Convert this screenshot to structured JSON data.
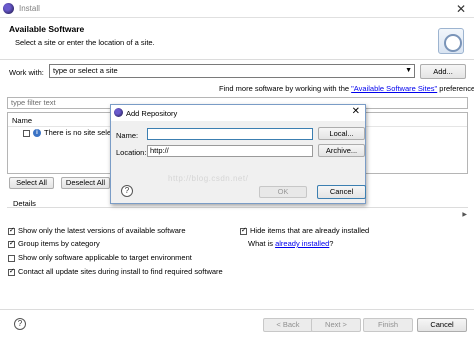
{
  "window": {
    "title": "Install",
    "close_glyph": "✕"
  },
  "hero": {
    "title": "Available Software",
    "subtitle": "Select a site or enter the location of a site."
  },
  "workwith": {
    "label": "Work with:",
    "placeholder": "type or select a site",
    "add_label": "Add...",
    "findmore_prefix": "Find more software by working with the ",
    "findmore_link": "\"Available Software Sites\"",
    "findmore_suffix": " preferences."
  },
  "filter": {
    "placeholder": "type filter text"
  },
  "tree": {
    "column_name": "Name",
    "info_glyph": "i",
    "row_text": "There is no site select"
  },
  "buttons": {
    "select_all": "Select All",
    "deselect_all": "Deselect All"
  },
  "details": {
    "label": "Details"
  },
  "options": {
    "latest_versions": "Show only the latest versions of available software",
    "group_by_category": "Group items by category",
    "target_env": "Show only software applicable to target environment",
    "contact_sites": "Contact all update sites during install to find required software",
    "hide_installed": "Hide items that are already installed",
    "what_is_prefix": "What is ",
    "what_is_link": "already installed",
    "what_is_suffix": "?"
  },
  "checks": {
    "latest_versions": true,
    "group_by_category": true,
    "target_env": false,
    "contact_sites": true,
    "hide_installed": true
  },
  "nav": {
    "back": "< Back",
    "next": "Next >",
    "finish": "Finish",
    "cancel": "Cancel",
    "help_glyph": "?"
  },
  "dialog": {
    "title": "Add Repository",
    "close_glyph": "✕",
    "name_label": "Name:",
    "name_value": "",
    "location_label": "Location:",
    "location_value": "http://",
    "local_button": "Local...",
    "archive_button": "Archive...",
    "ok_button": "OK",
    "cancel_button": "Cancel",
    "help_glyph": "?"
  },
  "watermark": "http://blog.csdn.net/"
}
